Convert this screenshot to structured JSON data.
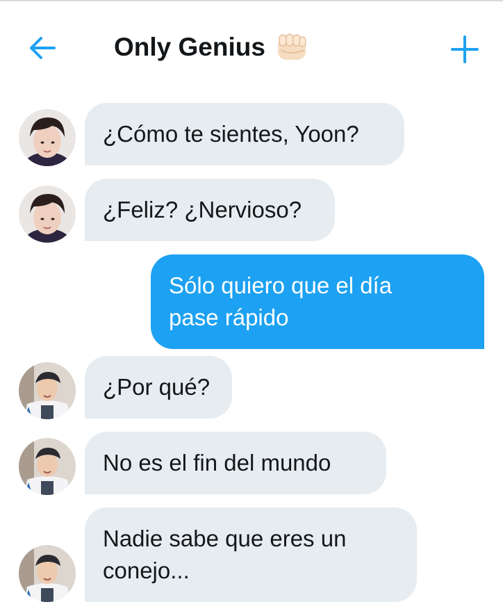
{
  "header": {
    "title": "Only Genius",
    "title_emoji_icon": "fist-bump-icon",
    "back_icon": "arrow-left-icon",
    "add_icon": "plus-icon",
    "accent_color": "#1da1f2"
  },
  "messages": [
    {
      "sender": "other",
      "avatar": "avatar-dark-hair",
      "text": "¿Cómo te sientes, Yoon?"
    },
    {
      "sender": "other",
      "avatar": "avatar-dark-hair",
      "text": "¿Feliz? ¿Nervioso?"
    },
    {
      "sender": "me",
      "text": "Sólo quiero que el día\npase rápido"
    },
    {
      "sender": "other",
      "avatar": "avatar-cap-tshirt",
      "text": "¿Por qué?"
    },
    {
      "sender": "other",
      "avatar": "avatar-cap-tshirt",
      "text": "No es el fin del mundo"
    },
    {
      "sender": "other",
      "avatar": "avatar-cap-tshirt",
      "text": "Nadie sabe que eres un\nconejo..."
    }
  ],
  "colors": {
    "incoming_bubble": "#e6ecf0",
    "outgoing_bubble": "#1da1f2",
    "text": "#14171a"
  }
}
